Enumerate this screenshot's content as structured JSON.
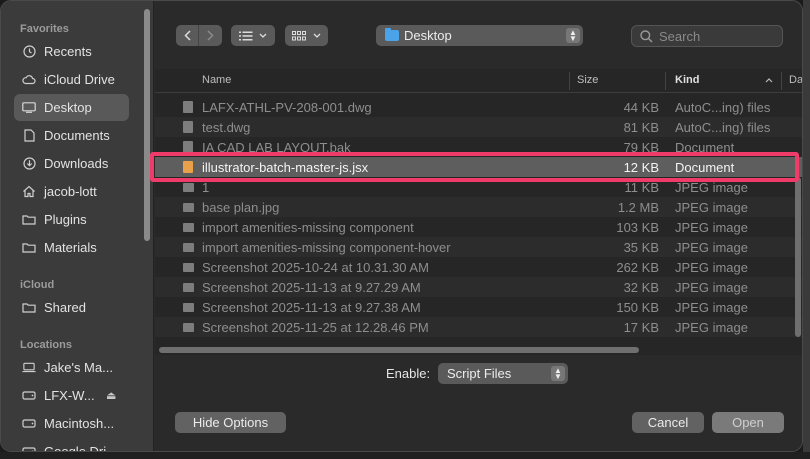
{
  "sidebar": {
    "favorites_label": "Favorites",
    "favorites": [
      {
        "label": "Recents",
        "icon": "clock-icon"
      },
      {
        "label": "iCloud Drive",
        "icon": "cloud-icon"
      },
      {
        "label": "Desktop",
        "icon": "desktop-icon",
        "selected": true
      },
      {
        "label": "Documents",
        "icon": "document-icon"
      },
      {
        "label": "Downloads",
        "icon": "download-icon"
      },
      {
        "label": "jacob-lott",
        "icon": "home-icon"
      },
      {
        "label": "Plugins",
        "icon": "folder-icon"
      },
      {
        "label": "Materials",
        "icon": "folder-icon"
      }
    ],
    "icloud_label": "iCloud",
    "icloud": [
      {
        "label": "Shared",
        "icon": "shared-folder-icon"
      }
    ],
    "locations_label": "Locations",
    "locations": [
      {
        "label": "Jake's Ma...",
        "icon": "laptop-icon"
      },
      {
        "label": "LFX-W...",
        "icon": "drive-icon",
        "eject": true
      },
      {
        "label": "Macintosh...",
        "icon": "drive-icon"
      },
      {
        "label": "Google Dri...",
        "icon": "drive-icon"
      }
    ]
  },
  "toolbar": {
    "location": "Desktop",
    "search_placeholder": "Search"
  },
  "columns": {
    "name": "Name",
    "size": "Size",
    "kind": "Kind",
    "date": "Da"
  },
  "files": [
    {
      "name": "LAFX-ATHL-PV-208-001.dwg",
      "size": "44 KB",
      "kind": "AutoC...ing) files",
      "type": "doc"
    },
    {
      "name": "test.dwg",
      "size": "81 KB",
      "kind": "AutoC...ing) files",
      "type": "doc"
    },
    {
      "name": "IA CAD LAB LAYOUT.bak",
      "size": "79 KB",
      "kind": "Document",
      "type": "doc"
    },
    {
      "name": "illustrator-batch-master-js.jsx",
      "size": "12 KB",
      "kind": "Document",
      "type": "jsx",
      "selected": true
    },
    {
      "name": "1",
      "size": "11 KB",
      "kind": "JPEG image",
      "type": "img"
    },
    {
      "name": "base plan.jpg",
      "size": "1.2 MB",
      "kind": "JPEG image",
      "type": "img"
    },
    {
      "name": "import amenities-missing component",
      "size": "103 KB",
      "kind": "JPEG image",
      "type": "img"
    },
    {
      "name": "import amenities-missing component-hover",
      "size": "35 KB",
      "kind": "JPEG image",
      "type": "img"
    },
    {
      "name": "Screenshot 2025-10-24 at 10.31.30 AM",
      "size": "262 KB",
      "kind": "JPEG image",
      "type": "img"
    },
    {
      "name": "Screenshot 2025-11-13 at 9.27.29 AM",
      "size": "32 KB",
      "kind": "JPEG image",
      "type": "img"
    },
    {
      "name": "Screenshot 2025-11-13 at 9.27.38 AM",
      "size": "150 KB",
      "kind": "JPEG image",
      "type": "img"
    },
    {
      "name": "Screenshot 2025-11-25 at 12.28.46 PM",
      "size": "17 KB",
      "kind": "JPEG image",
      "type": "img"
    }
  ],
  "bottom": {
    "enable_label": "Enable:",
    "enable_value": "Script Files",
    "hide_options": "Hide Options",
    "cancel": "Cancel",
    "open": "Open"
  },
  "colors": {
    "highlight": "#ef3b6a",
    "folder_accent": "#4aa3e8"
  }
}
